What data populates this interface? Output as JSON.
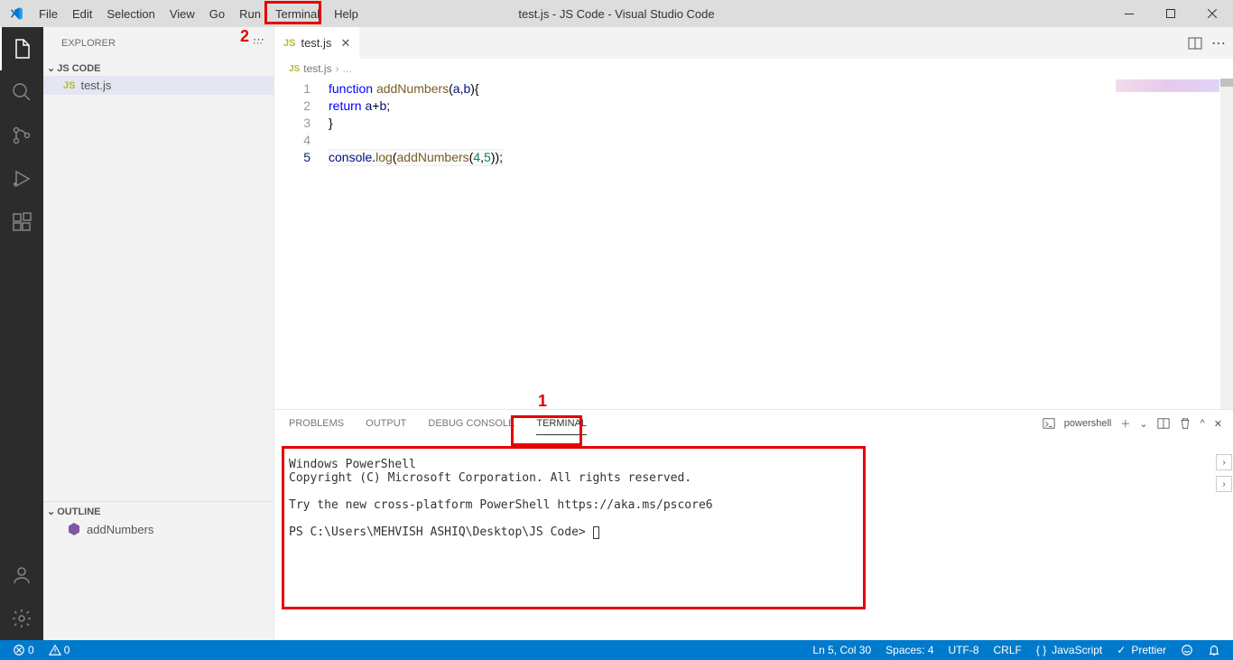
{
  "window": {
    "title": "test.js - JS Code - Visual Studio Code"
  },
  "menu": {
    "items": [
      "File",
      "Edit",
      "Selection",
      "View",
      "Go",
      "Run",
      "Terminal",
      "Help"
    ]
  },
  "sidebar": {
    "title": "EXPLORER",
    "project": "JS CODE",
    "file": "test.js",
    "outline_title": "OUTLINE",
    "outline_item": "addNumbers"
  },
  "tab": {
    "label": "test.js"
  },
  "breadcrumb": {
    "file": "test.js",
    "sep": "›",
    "rest": "..."
  },
  "code": {
    "lines": [
      {
        "n": "1",
        "tokens": [
          [
            "kw",
            "function "
          ],
          [
            "fn",
            "addNumbers"
          ],
          [
            "",
            ""
          ],
          [
            "",
            "("
          ],
          [
            "param",
            "a"
          ],
          [
            "",
            ","
          ],
          [
            "param",
            "b"
          ],
          [
            "",
            ")"
          ],
          [
            "",
            "{"
          ]
        ]
      },
      {
        "n": "2",
        "tokens": [
          [
            "",
            "    "
          ],
          [
            "kw",
            "return "
          ],
          [
            "param",
            "a"
          ],
          [
            "",
            "+"
          ],
          [
            "param",
            "b"
          ],
          [
            "",
            ";"
          ]
        ]
      },
      {
        "n": "3",
        "tokens": [
          [
            "",
            "}"
          ]
        ]
      },
      {
        "n": "4",
        "tokens": []
      },
      {
        "n": "5",
        "tokens": [
          [
            "param",
            "console"
          ],
          [
            "",
            ". "
          ],
          [
            "fn",
            "log"
          ],
          [
            "",
            "("
          ],
          [
            "fn",
            "addNumbers"
          ],
          [
            "",
            "("
          ],
          [
            "num",
            "4"
          ],
          [
            "",
            ","
          ],
          [
            "num",
            "5"
          ],
          [
            "",
            ")); "
          ]
        ]
      }
    ]
  },
  "panel": {
    "tabs": [
      "PROBLEMS",
      "OUTPUT",
      "DEBUG CONSOLE",
      "TERMINAL"
    ],
    "shell": "powershell",
    "terminal_lines": [
      "",
      "Windows PowerShell",
      "Copyright (C) Microsoft Corporation. All rights reserved.",
      "",
      "Try the new cross-platform PowerShell https://aka.ms/pscore6",
      "",
      "PS C:\\Users\\MEHVISH ASHIQ\\Desktop\\JS Code> "
    ]
  },
  "status": {
    "errors": "0",
    "warnings": "0",
    "ln_col": "Ln 5, Col 30",
    "spaces": "Spaces: 4",
    "encoding": "UTF-8",
    "eol": "CRLF",
    "lang": "JavaScript",
    "prettier": "Prettier"
  },
  "annotations": {
    "label1": "1",
    "label2": "2"
  }
}
